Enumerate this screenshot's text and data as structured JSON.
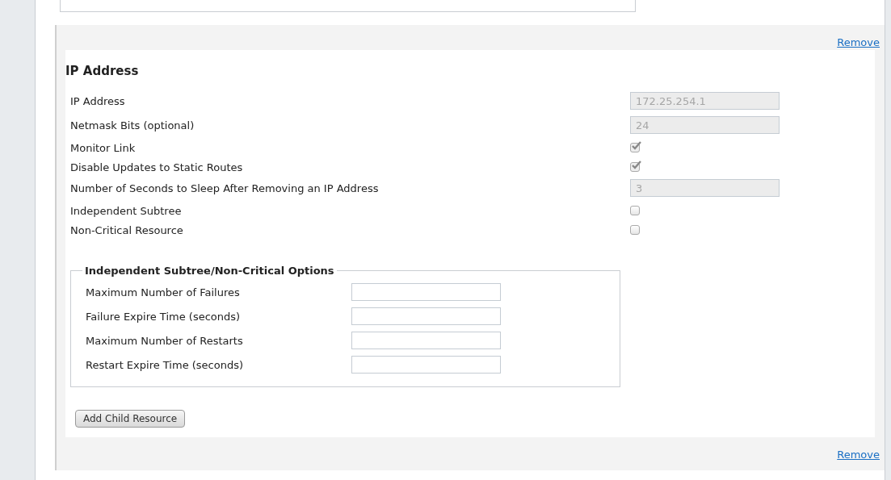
{
  "resources": [
    {
      "remove_link": "Remove",
      "title": "IP Address",
      "fields": [
        {
          "kind": "text",
          "label": "IP Address",
          "value": "172.25.254.1",
          "disabled": true
        },
        {
          "kind": "text",
          "label": "Netmask Bits (optional)",
          "value": "24",
          "disabled": true
        },
        {
          "kind": "checkbox",
          "label": "Monitor Link",
          "checked": true,
          "disabled": true
        },
        {
          "kind": "checkbox",
          "label": "Disable Updates to Static Routes",
          "checked": true,
          "disabled": true
        },
        {
          "kind": "text",
          "label": "Number of Seconds to Sleep After Removing an IP Address",
          "value": "3",
          "disabled": true
        },
        {
          "kind": "checkbox",
          "label": "Independent Subtree",
          "checked": false,
          "disabled": false
        },
        {
          "kind": "checkbox",
          "label": "Non-Critical Resource",
          "checked": false,
          "disabled": false
        }
      ],
      "options": {
        "legend": "Independent Subtree/Non-Critical Options",
        "fields": [
          {
            "label": "Maximum Number of Failures"
          },
          {
            "label": "Failure Expire Time (seconds)"
          },
          {
            "label": "Maximum Number of Restarts"
          },
          {
            "label": "Restart Expire Time (seconds)"
          }
        ]
      },
      "button": "Add Child Resource"
    },
    {
      "remove_link": "Remove"
    }
  ]
}
